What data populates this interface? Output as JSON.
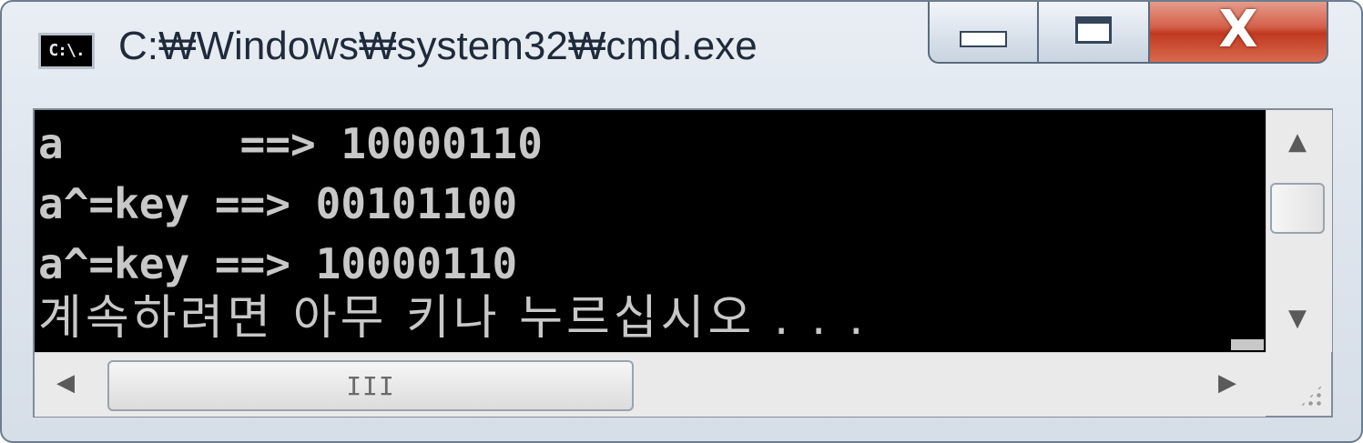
{
  "window": {
    "icon_text": "C:\\.",
    "title": "C:₩Windows₩system32₩cmd.exe"
  },
  "caption_buttons": {
    "close_glyph": "X"
  },
  "console": {
    "lines": [
      "a       ==> 10000110",
      "a^=key ==> 00101100",
      "a^=key ==> 10000110",
      "계속하려면 아무 키나 누르십시오 . . ."
    ]
  },
  "scrollbars": {
    "up_arrow": "▲",
    "down_arrow": "▼",
    "left_arrow": "◀",
    "right_arrow": "▶",
    "h_thumb_grip": "III"
  },
  "colors": {
    "console_bg": "#000000",
    "console_fg": "#c8c8c8",
    "close_button": "#c0391f"
  },
  "icons": {
    "app": "cmd-icon",
    "minimize": "minimize-icon",
    "maximize": "maximize-icon",
    "close": "close-icon"
  }
}
